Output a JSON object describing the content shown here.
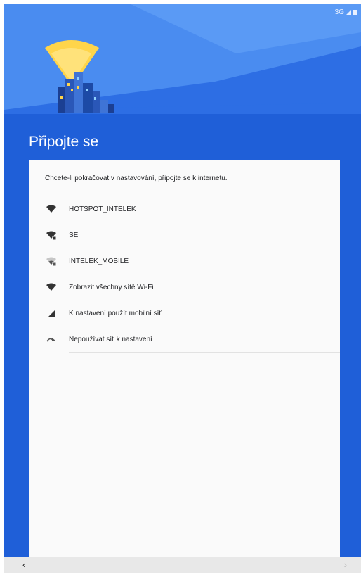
{
  "status_bar": {
    "network": "3G"
  },
  "page": {
    "title": "Připojte se"
  },
  "card": {
    "intro": "Chcete-li pokračovat v nastavování, připojte se k internetu.",
    "items": [
      {
        "label": "HOTSPOT_INTELEK",
        "icon": "wifi-icon"
      },
      {
        "label": "SE",
        "icon": "wifi-locked-icon"
      },
      {
        "label": "INTELEK_MOBILE",
        "icon": "wifi-weak-locked-icon"
      },
      {
        "label": "Zobrazit všechny sítě Wi-Fi",
        "icon": "wifi-icon"
      },
      {
        "label": "K nastavení použít mobilní síť",
        "icon": "cellular-signal-icon"
      },
      {
        "label": "Nepoužívat síť k nastavení",
        "icon": "skip-arrow-icon"
      }
    ]
  },
  "navbar": {
    "back": "‹",
    "next": "›"
  },
  "colors": {
    "background": "#1f5fd8",
    "header": "#2d6ee4",
    "beam": "#ffd54a",
    "card": "#fafafa",
    "navbar": "#e8e8e8"
  }
}
